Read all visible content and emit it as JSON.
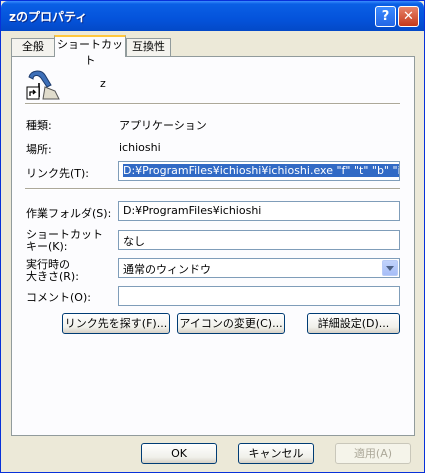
{
  "window": {
    "title": "zのプロパティ"
  },
  "titlebar": {
    "help_glyph": "?",
    "close_glyph": "✕"
  },
  "tabs": [
    {
      "label": "全般"
    },
    {
      "label": "ショートカット",
      "active": true
    },
    {
      "label": "互換性"
    }
  ],
  "shortcut": {
    "name": "z",
    "type_label": "種類:",
    "type_value": "アプリケーション",
    "location_label": "場所:",
    "location_value": "ichioshi",
    "target_label": "リンク先(T):",
    "target_value": "D:¥ProgramFiles¥ichioshi¥ichioshi.exe \"f\" \"t\" \"b\" \"i",
    "startin_label": "作業フォルダ(S):",
    "startin_value": "D:¥ProgramFiles¥ichioshi",
    "hotkey_label_1": "ショートカット",
    "hotkey_label_2": "キー(K):",
    "hotkey_value": "なし",
    "run_label_1": "実行時の",
    "run_label_2": "大きさ(R):",
    "run_value": "通常のウィンドウ",
    "comment_label": "コメント(O):",
    "comment_value": ""
  },
  "buttons": {
    "find_target": "リンク先を探す(F)...",
    "change_icon": "アイコンの変更(C)...",
    "advanced": "詳細設定(D)...",
    "ok": "OK",
    "cancel": "キャンセル",
    "apply": "適用(A)"
  },
  "colors": {
    "titlebar": "#0453DB",
    "selection": "#316AC5",
    "face": "#ECE9D8"
  }
}
